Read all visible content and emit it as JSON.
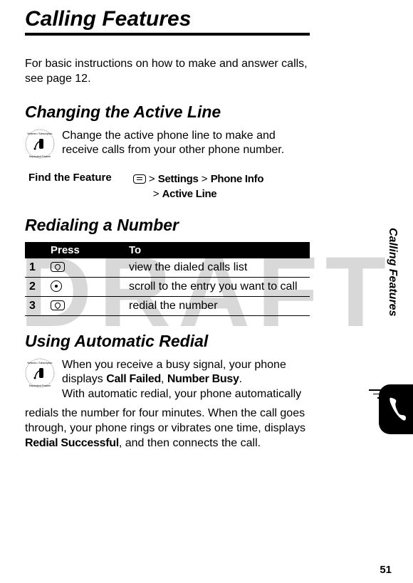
{
  "watermark": "DRAFT",
  "title": "Calling Features",
  "intro": "For basic instructions on how to make and answer calls, see page 12.",
  "sect1": {
    "heading": "Changing the Active Line",
    "body": "Change the active phone line to make and receive calls from your other phone number."
  },
  "findFeature": {
    "label": "Find the Feature",
    "path1a": "Settings",
    "path1b": "Phone Info",
    "path2": "Active Line"
  },
  "sect2": {
    "heading": "Redialing a Number"
  },
  "table": {
    "head": {
      "c1": "",
      "c2": "Press",
      "c3": "To"
    },
    "rows": [
      {
        "n": "1",
        "to": "view the dialed calls list"
      },
      {
        "n": "2",
        "to": "scroll to the entry you want to call"
      },
      {
        "n": "3",
        "to": "redial the number"
      }
    ]
  },
  "sect3": {
    "heading": "Using Automatic Redial"
  },
  "sect4": {
    "line1a": "When you receive a busy signal, your phone displays ",
    "callFailed": "Call Failed",
    "comma": ", ",
    "numberBusy": "Number Busy",
    "period": ".",
    "line2a": "With automatic redial, your phone automatically",
    "rest1": "redials the number for four minutes. When the call goes through, your phone rings or vibrates one time, displays ",
    "redialSuccessful": "Redial Successful",
    "rest2": ", and then connects the call."
  },
  "sideTab": "Calling Features",
  "pageNum": "51"
}
